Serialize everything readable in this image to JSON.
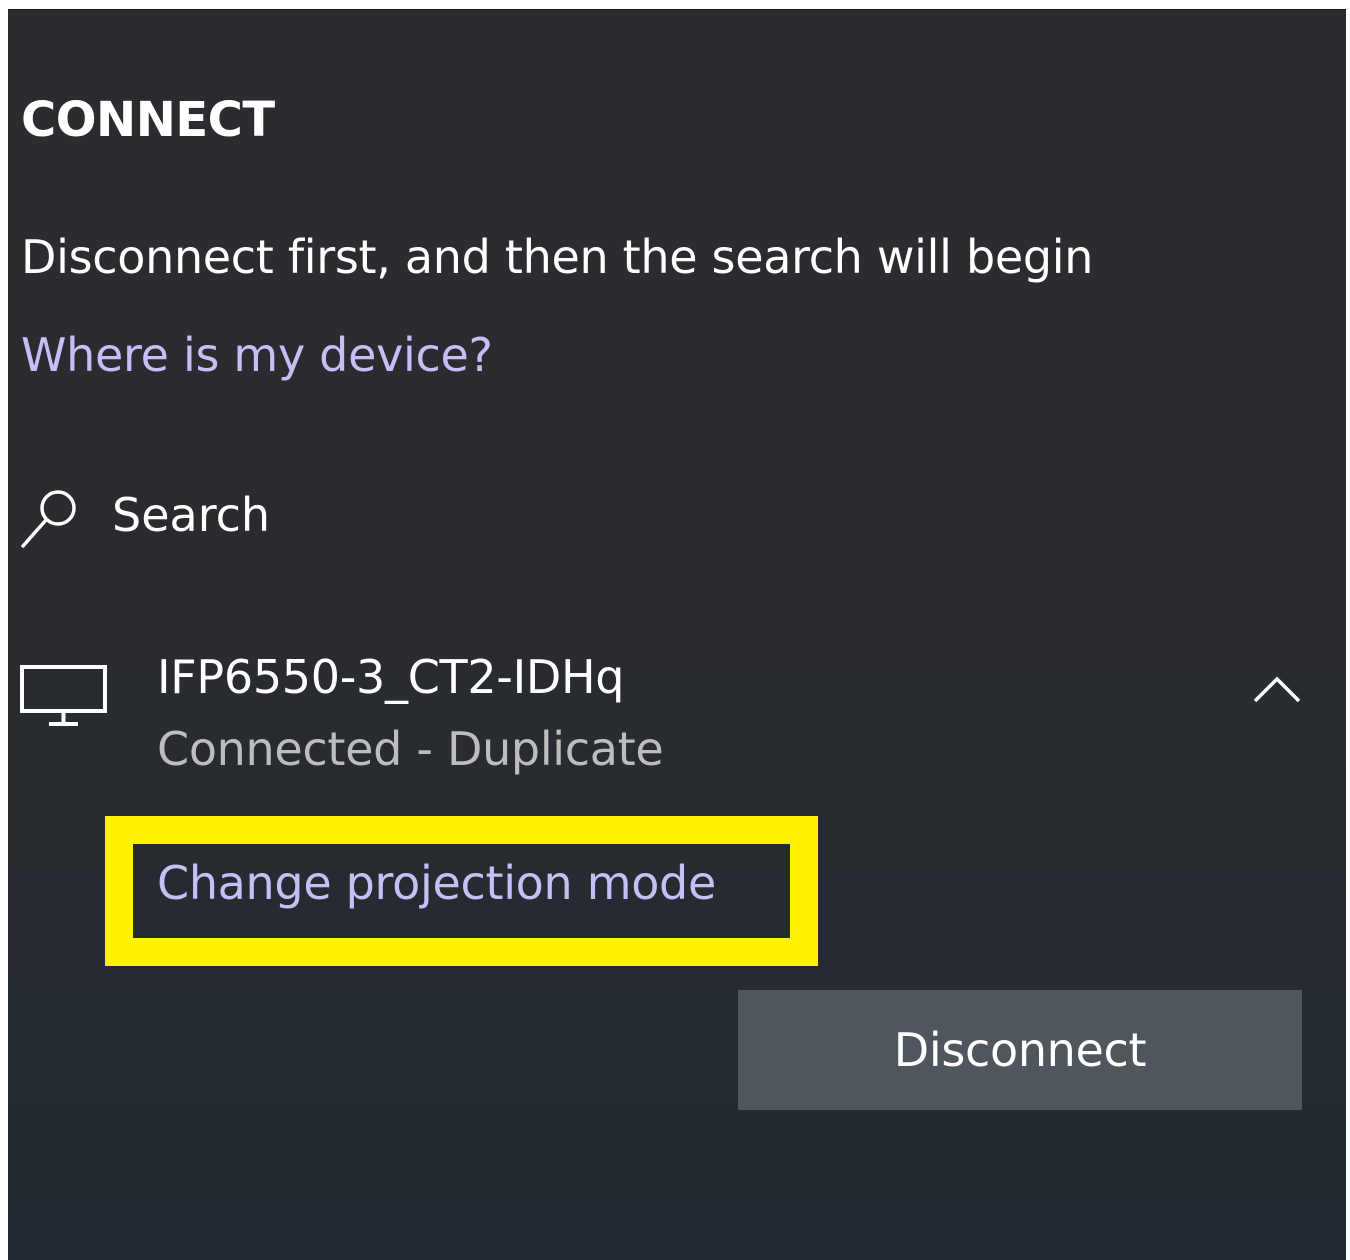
{
  "connect_panel": {
    "title": "CONNECT",
    "message": "Disconnect first, and then the search will begin",
    "help_link": "Where is my device?",
    "search": {
      "label": "Search",
      "icon": "search-icon"
    },
    "device": {
      "icon": "monitor-icon",
      "name": "IFP6550-3_CT2-IDHq",
      "status": "Connected - Duplicate",
      "expand_icon": "chevron-up-icon",
      "projection_link": "Change projection mode",
      "disconnect_label": "Disconnect"
    }
  },
  "colors": {
    "background": "#2a2b2f",
    "link": "#c6bff5",
    "status_text": "#bdbdbd",
    "button": "#4f565c",
    "highlight": "#fff200"
  }
}
